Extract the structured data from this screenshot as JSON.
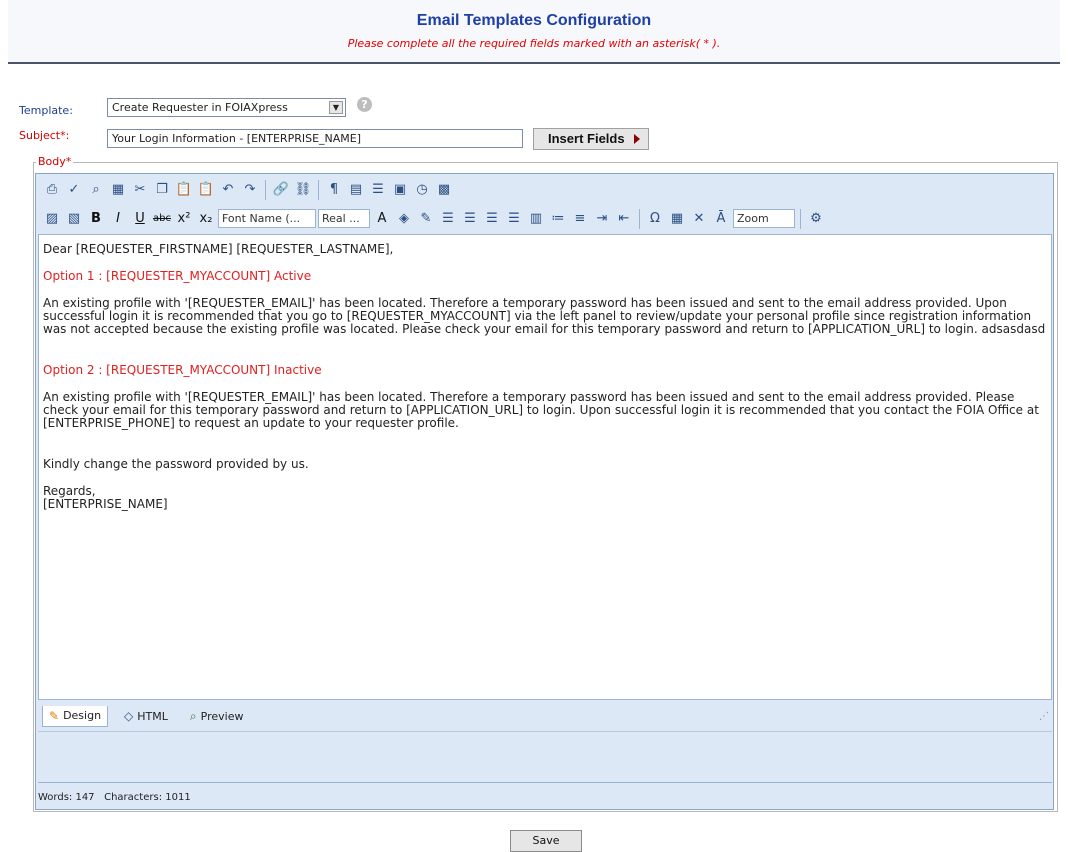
{
  "page": {
    "title": "Email Templates Configuration",
    "subtitle": "Please complete all the required fields marked with an asterisk( * )."
  },
  "form": {
    "template_label": "Template:",
    "template_value": "Create Requester in FOIAXpress",
    "help_glyph": "?",
    "subject_label": "Subject*:",
    "subject_value": "Your Login Information - [ENTERPRISE_NAME]",
    "insert_fields_label": "Insert Fields",
    "body_label": "Body*"
  },
  "toolbar": {
    "font_name": "Font Name (...",
    "font_size": "Real ...",
    "zoom": "Zoom"
  },
  "body": {
    "greeting": "Dear [REQUESTER_FIRSTNAME] [REQUESTER_LASTNAME],",
    "option1_heading": "Option 1 : [REQUESTER_MYACCOUNT] Active",
    "option1_text": "An existing profile with '[REQUESTER_EMAIL]' has been located. Therefore a temporary password has been issued and sent to the email address provided. Upon successful login it is recommended that you go to [REQUESTER_MYACCOUNT] via the left panel to review/update your personal profile since registration information was not accepted because the existing profile was located. Please check your email for this temporary password and return to [APPLICATION_URL] to login. adsasdasd",
    "option2_heading": "Option 2 : [REQUESTER_MYACCOUNT] Inactive",
    "option2_text": "An existing profile with '[REQUESTER_EMAIL]' has been located. Therefore a temporary password has been issued and sent to the email address provided. Please check your email for this temporary password and return to [APPLICATION_URL] to login. Upon successful login it is recommended that you contact the FOIA Office at [ENTERPRISE_PHONE] to request an update to your requester profile.",
    "closing_line": "Kindly change the password provided by us.",
    "regards": "Regards,",
    "signature": "[ENTERPRISE_NAME]"
  },
  "modes": {
    "design": "Design",
    "html": "HTML",
    "preview": "Preview"
  },
  "status": {
    "words_label": "Words: 147",
    "characters_label": "Characters: 1011"
  },
  "actions": {
    "save": "Save"
  },
  "colors": {
    "title": "#1f3fa8",
    "required": "#d00000",
    "editor_bg": "#dce8f6"
  },
  "icons": [
    "print-icon",
    "spellcheck-icon",
    "find-icon",
    "select-all-icon",
    "cut-icon",
    "copy-icon",
    "paste-icon",
    "paste-options-icon",
    "undo-icon",
    "redo-icon",
    "link-icon",
    "unlink-icon",
    "paragraph-icon",
    "template-icon",
    "horizontal-rule-icon",
    "form-icon",
    "datetime-icon",
    "image-map-icon",
    "image-manager-icon",
    "image-properties-icon",
    "bold-icon",
    "italic-icon",
    "underline-icon",
    "strikethrough-icon",
    "superscript-icon",
    "subscript-icon",
    "font-color-icon",
    "highlight-icon",
    "format-brush-icon",
    "align-left-icon",
    "align-center-icon",
    "align-right-icon",
    "justify-icon",
    "cell-align-icon",
    "bullet-list-icon",
    "numbered-list-icon",
    "indent-icon",
    "outdent-icon",
    "symbol-icon",
    "table-icon",
    "strip-format-icon",
    "ai-icon",
    "tools-icon",
    "pencil-icon",
    "code-icon",
    "magnifier-icon"
  ]
}
